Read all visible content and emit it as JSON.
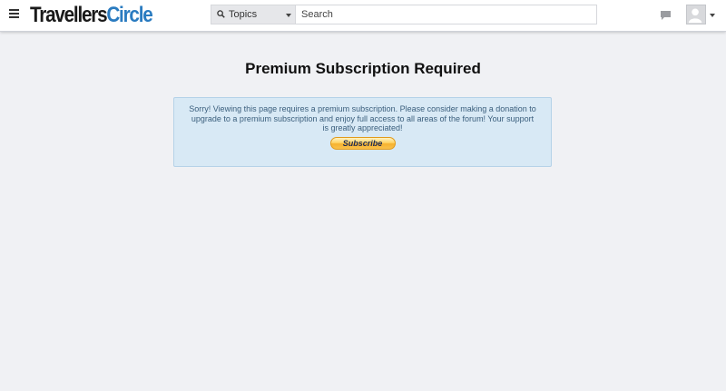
{
  "header": {
    "logo_part1": "Travellers",
    "logo_part2": "Circle",
    "menu_icon": "hamburger-menu-icon",
    "search": {
      "scope_label": "Topics",
      "scope_icon": "search-icon",
      "placeholder": "Search"
    },
    "messages_icon": "chat-bubble-icon",
    "avatar_icon": "user-avatar-icon"
  },
  "main": {
    "title": "Premium Subscription Required",
    "notice_text": "Sorry! Viewing this page requires a premium subscription. Please consider making a donation to upgrade to a premium subscription and enjoy full access to all areas of the forum! Your support is greatly appreciated!",
    "subscribe_label": "Subscribe"
  },
  "colors": {
    "background": "#f0f1f4",
    "logo_accent": "#2a7bc0",
    "notice_bg": "#d8e9f5",
    "notice_text": "#3b5f7d",
    "button_gold": "#ffd463"
  }
}
